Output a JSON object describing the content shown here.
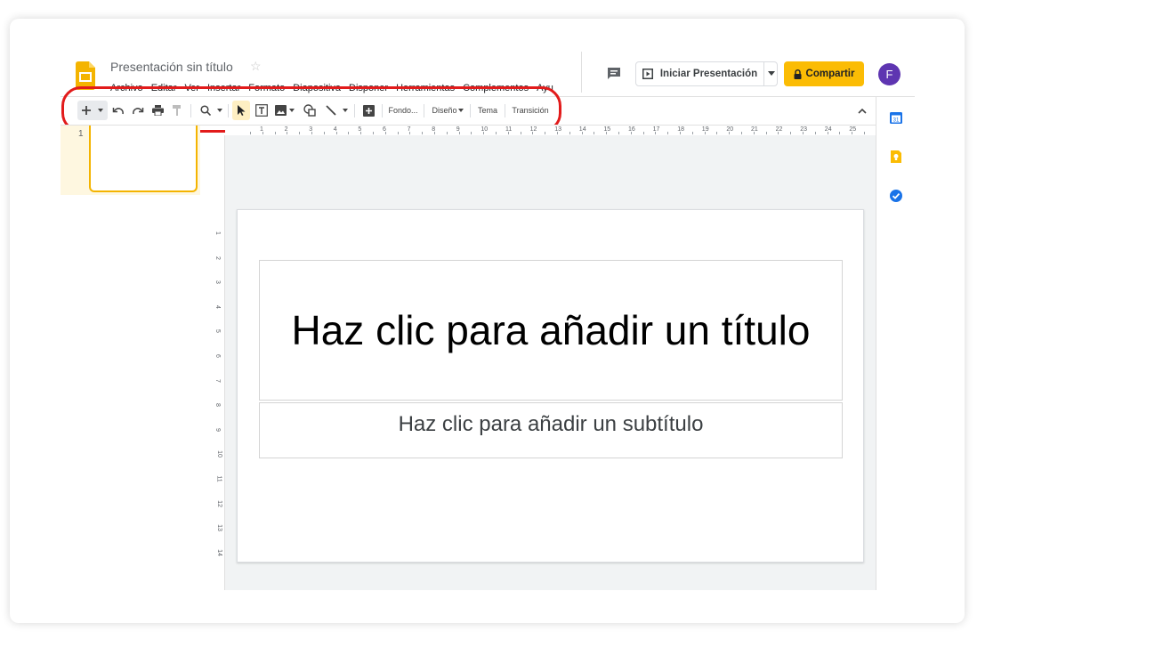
{
  "app": {
    "doc_title": "Presentación sin título",
    "menu": [
      "Archivo",
      "Editar",
      "Ver",
      "Insertar",
      "Formato",
      "Diapositiva",
      "Disponer",
      "Herramientas",
      "Complementos",
      "Ayu"
    ]
  },
  "header": {
    "present_label": "Iniciar Presentación",
    "share_label": "Compartir",
    "avatar_initial": "F"
  },
  "toolbar": {
    "fondo": "Fondo...",
    "diseno": "Diseño",
    "tema": "Tema",
    "transicion": "Transición"
  },
  "filmstrip": {
    "slide_number": "1"
  },
  "slide": {
    "title_placeholder": "Haz clic para añadir un título",
    "subtitle_placeholder": "Haz clic para añadir un subtítulo"
  },
  "rulers": {
    "horizontal": [
      "1",
      "2",
      "3",
      "4",
      "5",
      "6",
      "7",
      "8",
      "9",
      "10",
      "11",
      "12",
      "13",
      "14",
      "15",
      "16",
      "17",
      "18",
      "19",
      "20",
      "21",
      "22",
      "23",
      "24",
      "25"
    ],
    "vertical": [
      "1",
      "2",
      "3",
      "4",
      "5",
      "6",
      "7",
      "8",
      "9",
      "10",
      "11",
      "12",
      "13",
      "14"
    ]
  },
  "colors": {
    "accent_yellow": "#fbbc04",
    "avatar": "#5e35b1",
    "highlight_ring": "#e21b1b",
    "selected_slide": "#f4b400"
  },
  "icons": {
    "logo": "google-slides-logo",
    "star": "star-icon",
    "comment": "comment-icon",
    "calendar": "calendar-icon",
    "keep": "keep-icon",
    "tasks": "tasks-icon"
  }
}
